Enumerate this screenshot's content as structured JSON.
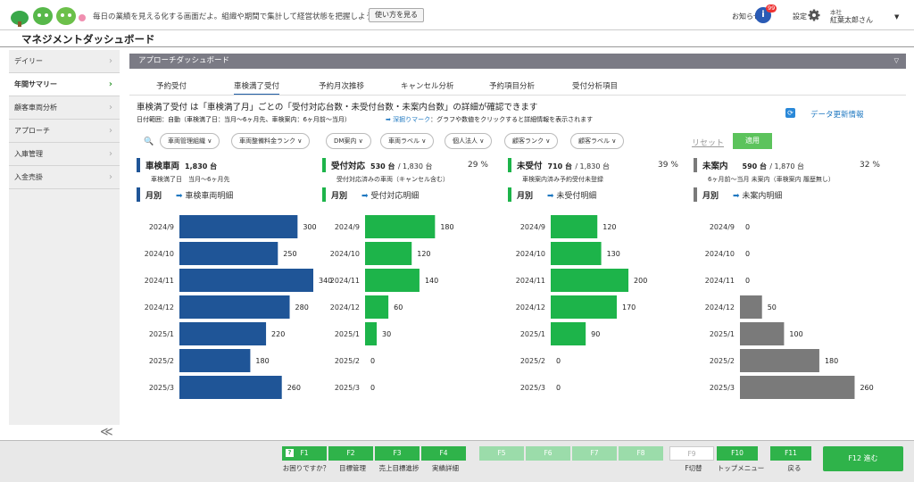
{
  "header": {
    "banner": "毎日の業績を見える化する画面だよ。組織や期間で集計して経営状態を把握しようね。",
    "howto_label": "使い方を見る",
    "notification_label": "お知らせ",
    "notification_count": "99",
    "settings_label": "設定",
    "user_company": "本社",
    "user_name": "紅葉太郎さん"
  },
  "page_title": "マネジメントダッシュボード",
  "sidebar": {
    "items": [
      {
        "label": "デイリー",
        "active": false
      },
      {
        "label": "年間サマリー",
        "active": true
      },
      {
        "label": "顧客車両分析",
        "active": false
      },
      {
        "label": "アプローチ",
        "active": false
      },
      {
        "label": "入庫管理",
        "active": false
      },
      {
        "label": "入金売掛",
        "active": false
      }
    ],
    "collapse": "≪"
  },
  "panel": {
    "title": "アプローチダッシュボード",
    "tabs": [
      "予約受付",
      "車検満了受付",
      "予約月次推移",
      "キャンセル分析",
      "予約項目分析",
      "受付分析項目"
    ],
    "active_tab": 1,
    "description": "車検満了受付 は「車検満了月」ごとの「受付対応台数・未受付台数・未案内台数」の詳細が確認できます",
    "date_range": "日付範囲：自動（車検満了日：当月〜6ヶ月先、車検案内：6ヶ月前〜当月）",
    "deep_dive_label": "➡ 深掘りマーク",
    "deep_dive_text": "：グラフや数値をクリックすると詳細情報を表示されます",
    "refresh_label": "データ更新情報"
  },
  "filters": {
    "items": [
      "車両管理組織 ∨",
      "車両整備料金ランク ∨",
      "DM案内 ∨",
      "車両ラベル ∨",
      "個人法人 ∨",
      "顧客ランク ∨",
      "顧客ラベル ∨"
    ],
    "reset_label": "リセット",
    "apply_label": "適用"
  },
  "cards": [
    {
      "title": "車検車両",
      "count": "1,830 台",
      "total": "",
      "pct": "",
      "subtitle": "車検満了日　当月〜6ヶ月先",
      "monthly": "月別",
      "detail": "車検車両明細",
      "color": "#1f5597"
    },
    {
      "title": "受付対応",
      "count": "530 台",
      "total": "/ 1,830 台",
      "pct": "29 %",
      "subtitle": "受付対応済みの車両（キャンセル含む）",
      "monthly": "月別",
      "detail": "受付対応明細",
      "color": "#1db44a"
    },
    {
      "title": "未受付",
      "count": "710 台",
      "total": "/ 1,830 台",
      "pct": "39 %",
      "subtitle": "車検案内済み予約受付未登録",
      "monthly": "月別",
      "detail": "未受付明細",
      "color": "#1db44a"
    },
    {
      "title": "未案内",
      "count": "590 台",
      "total": "/ 1,870 台",
      "pct": "32 %",
      "subtitle": "6ヶ月前〜当月 未案内（車検案内 履歴無し）",
      "monthly": "月別",
      "detail": "未案内明細",
      "color": "#7a7a7a"
    }
  ],
  "chart_data": [
    {
      "type": "bar",
      "orientation": "horizontal",
      "categories": [
        "2024/9",
        "2024/10",
        "2024/11",
        "2024/12",
        "2025/1",
        "2025/2",
        "2025/3"
      ],
      "values": [
        300,
        250,
        340,
        280,
        220,
        180,
        260
      ],
      "color": "#1f5597"
    },
    {
      "type": "bar",
      "orientation": "horizontal",
      "categories": [
        "2024/9",
        "2024/10",
        "2024/11",
        "2024/12",
        "2025/1",
        "2025/2",
        "2025/3"
      ],
      "values": [
        180,
        120,
        140,
        60,
        30,
        0,
        0
      ],
      "color": "#1db44a"
    },
    {
      "type": "bar",
      "orientation": "horizontal",
      "categories": [
        "2024/9",
        "2024/10",
        "2024/11",
        "2024/12",
        "2025/1",
        "2025/2",
        "2025/3"
      ],
      "values": [
        120,
        130,
        200,
        170,
        90,
        0,
        0
      ],
      "color": "#1db44a"
    },
    {
      "type": "bar",
      "orientation": "horizontal",
      "categories": [
        "2024/9",
        "2024/10",
        "2024/11",
        "2024/12",
        "2025/1",
        "2025/2",
        "2025/3"
      ],
      "values": [
        0,
        0,
        0,
        50,
        100,
        180,
        260
      ],
      "color": "#7a7a7a"
    }
  ],
  "footer": {
    "keys": [
      {
        "key": "F1",
        "caption": "お困りですか？",
        "state": "on"
      },
      {
        "key": "F2",
        "caption": "目標管理",
        "state": "on"
      },
      {
        "key": "F3",
        "caption": "売上目標進捗",
        "state": "on"
      },
      {
        "key": "F4",
        "caption": "実績詳細",
        "state": "on"
      },
      {
        "key": "F5",
        "caption": "",
        "state": "dis"
      },
      {
        "key": "F6",
        "caption": "",
        "state": "dis"
      },
      {
        "key": "F7",
        "caption": "",
        "state": "dis"
      },
      {
        "key": "F8",
        "caption": "",
        "state": "dis"
      },
      {
        "key": "F9",
        "caption": "F切替",
        "state": "off"
      },
      {
        "key": "F10",
        "caption": "トップメニュー",
        "state": "on"
      },
      {
        "key": "F11",
        "caption": "戻る",
        "state": "on"
      }
    ],
    "f12_label": "F12 進む"
  }
}
